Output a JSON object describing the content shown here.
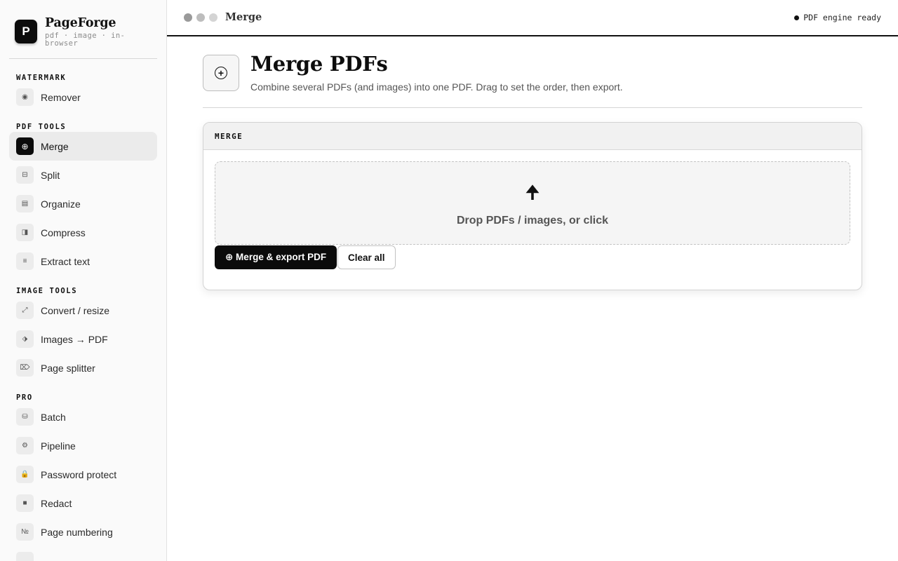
{
  "brand": {
    "logo_letter": "P",
    "name": "PageForge",
    "tagline": "pdf · image · in-browser"
  },
  "sidebar": {
    "sections": [
      {
        "label": "WATERMARK",
        "items": [
          {
            "label": "Remover",
            "icon": "◉",
            "icon_name": "watermark-remover-icon",
            "active": false
          }
        ]
      },
      {
        "label": "PDF TOOLS",
        "items": [
          {
            "label": "Merge",
            "icon": "⊕",
            "icon_name": "merge-icon",
            "active": true
          },
          {
            "label": "Split",
            "icon": "⊟",
            "icon_name": "split-icon",
            "active": false
          },
          {
            "label": "Organize",
            "icon": "▤",
            "icon_name": "organize-icon",
            "active": false
          },
          {
            "label": "Compress",
            "icon": "◨",
            "icon_name": "compress-icon",
            "active": false
          },
          {
            "label": "Extract text",
            "icon": "≡",
            "icon_name": "extract-text-icon",
            "active": false
          }
        ]
      },
      {
        "label": "IMAGE TOOLS",
        "items": [
          {
            "label": "Convert / resize",
            "icon": "⤢",
            "icon_name": "convert-resize-icon",
            "active": false
          },
          {
            "label": "Images → PDF",
            "icon": "⬗",
            "icon_name": "images-to-pdf-icon",
            "active": false
          },
          {
            "label": "Page splitter",
            "icon": "⌦",
            "icon_name": "page-splitter-icon",
            "active": false
          }
        ]
      },
      {
        "label": "PRO",
        "items": [
          {
            "label": "Batch",
            "icon": "⛁",
            "icon_name": "batch-icon",
            "active": false
          },
          {
            "label": "Pipeline",
            "icon": "⚙",
            "icon_name": "pipeline-icon",
            "active": false
          },
          {
            "label": "Password protect",
            "icon": "🔒",
            "icon_name": "lock-icon",
            "active": false
          },
          {
            "label": "Redact",
            "icon": "■",
            "icon_name": "redact-icon",
            "active": false
          },
          {
            "label": "Page numbering",
            "icon": "№",
            "icon_name": "page-numbering-icon",
            "active": false
          },
          {
            "label": "",
            "icon": "",
            "icon_name": "more-tool-icon",
            "active": false
          }
        ]
      }
    ]
  },
  "topbar": {
    "title": "Merge",
    "status": "PDF engine ready"
  },
  "page": {
    "title": "Merge PDFs",
    "subtitle": "Combine several PDFs (and images) into one PDF. Drag to set the order, then export.",
    "icon": "+"
  },
  "card": {
    "header": "MERGE",
    "dropzone_icon": "🠉",
    "dropzone_text": "Drop PDFs / images, or click",
    "primary_button": "⊕ Merge & export PDF",
    "secondary_button": "Clear all"
  },
  "colors": {
    "accent": "#0b0b0b",
    "window_dots": [
      "#9a9a9a",
      "#bdbdbd",
      "#d4d4d4"
    ]
  }
}
